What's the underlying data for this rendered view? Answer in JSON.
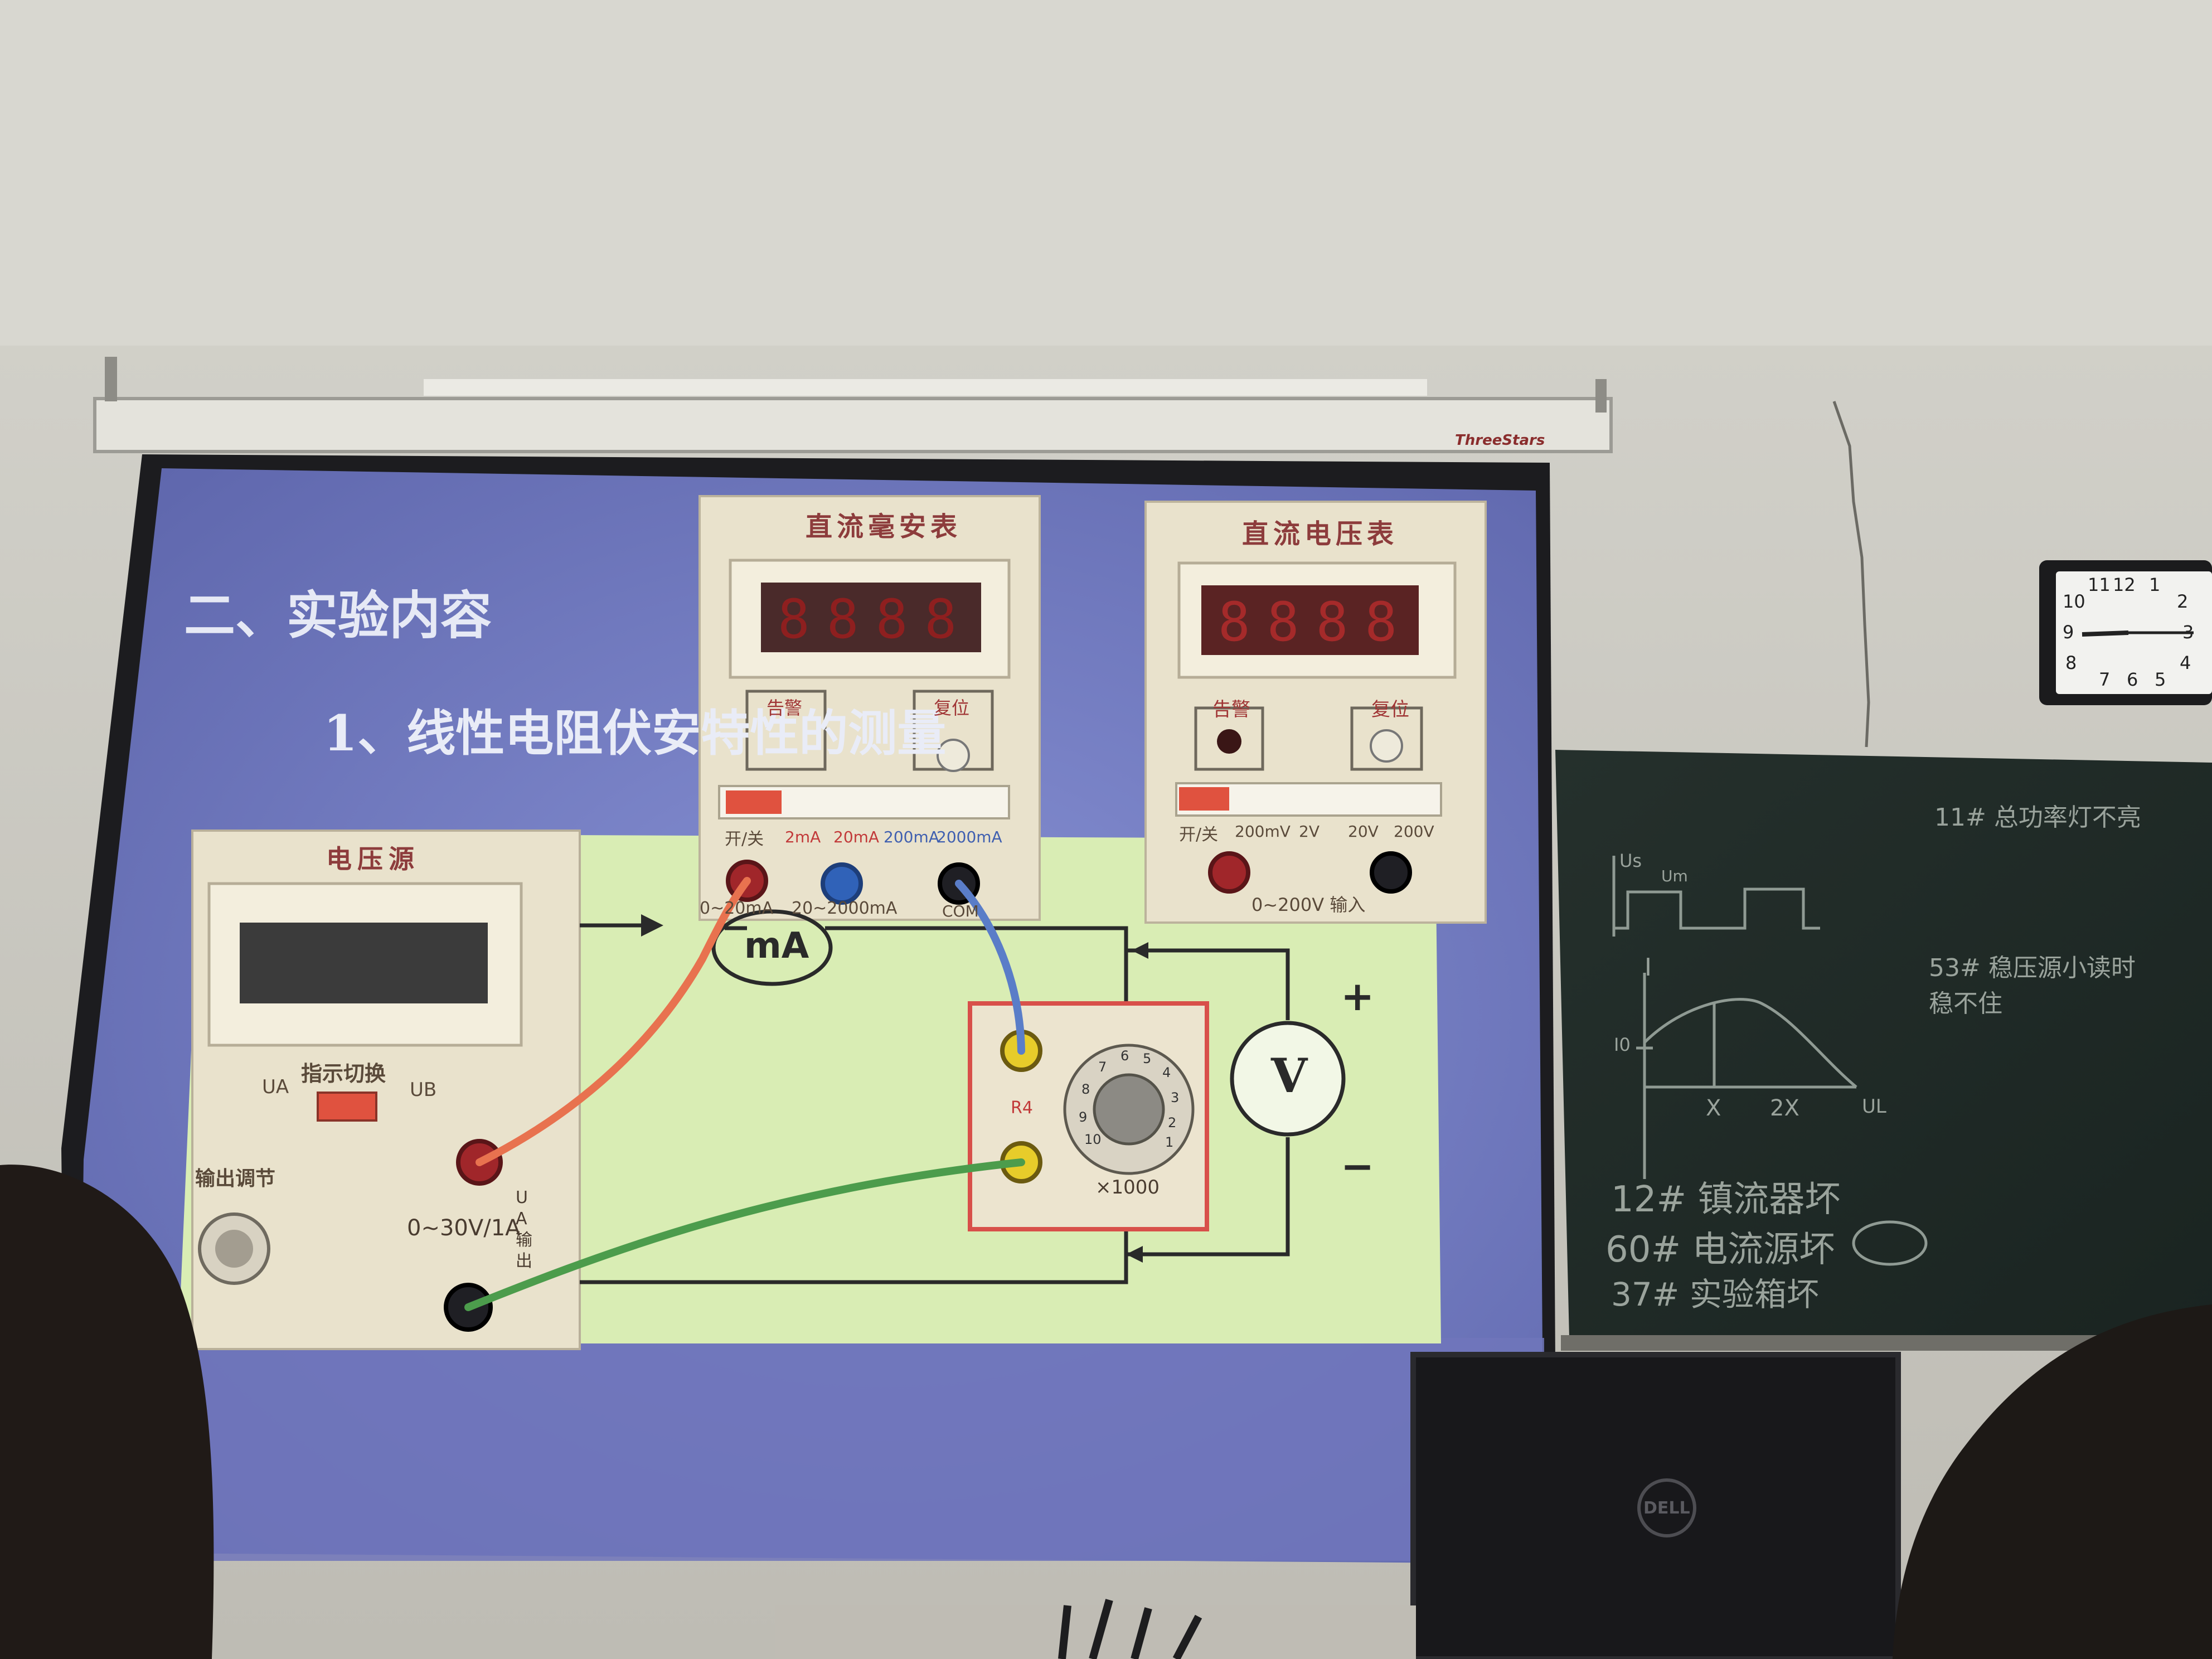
{
  "slide": {
    "heading": "二、实验内容",
    "subheading": "1、线性电阻伏安特性的测量"
  },
  "ammeter": {
    "title": "直流毫安表",
    "display": "8888",
    "alarm_label": "告警",
    "reset_label": "复位",
    "switch_labels": [
      "开/关",
      "2mA",
      "20mA",
      "200mA",
      "2000mA"
    ],
    "terminal_labels": [
      "0~20mA",
      "20~2000mA",
      "COM"
    ]
  },
  "voltmeter": {
    "title": "直流电压表",
    "display": "8888",
    "alarm_label": "告警",
    "reset_label": "复位",
    "switch_labels": [
      "开/关",
      "200mV",
      "2V",
      "20V",
      "200V"
    ],
    "input_label": "0~200V 输入"
  },
  "power_supply": {
    "title": "电压源",
    "indicator_label": "指示切换",
    "ua": "UA",
    "ub": "UB",
    "adjust_label": "输出调节",
    "range_label": "0~30V/1A",
    "output_label": "UA 输出"
  },
  "resistor_box": {
    "label": "R4",
    "multiplier": "×1000",
    "dial": [
      "1",
      "2",
      "3",
      "4",
      "5",
      "6",
      "7",
      "8",
      "9",
      "10"
    ]
  },
  "circuit": {
    "ammeter_symbol": "mA",
    "voltmeter_symbol": "V",
    "plus": "+",
    "minus": "−"
  },
  "screen_brand": "ThreeStars",
  "monitor_brand": "DELL",
  "clock_numbers": [
    "11",
    "12",
    "1",
    "2",
    "3",
    "4",
    "5",
    "6",
    "7",
    "8",
    "9",
    "10"
  ],
  "blackboard": {
    "line1": "12# 镇流器坏",
    "line2": "60# 电流源坏",
    "line3": "37# 实验箱坏",
    "note_top": "11# 总功率灯不亮",
    "note_mid": "53# 稳压源小读时 稳不住",
    "graph_labels": [
      "Us",
      "Um",
      "I",
      "I0",
      "X",
      "2X",
      "UL"
    ]
  },
  "colors": {
    "slide_blue": "#6f78c0",
    "diagram_bg": "#d9edb4",
    "panel_cream": "#e9e2cc",
    "chalkboard": "#1f2a27",
    "wire_red": "#e8724f",
    "wire_blue": "#5a7dc8",
    "wire_green": "#4c9c4c"
  }
}
